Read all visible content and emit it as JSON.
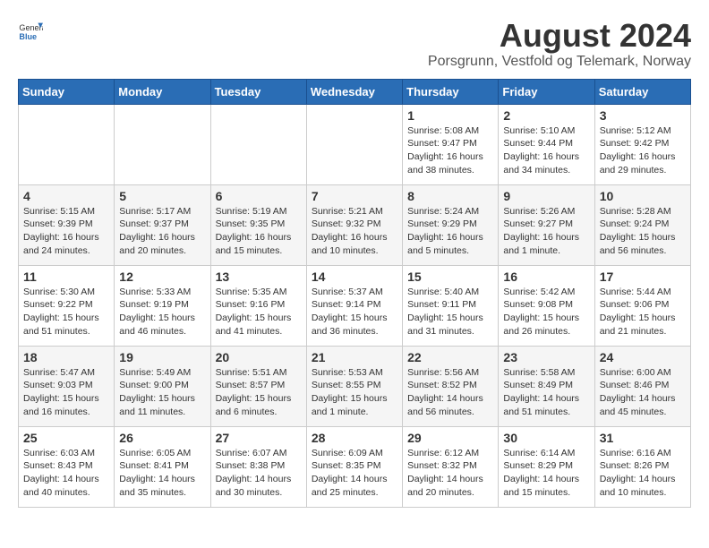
{
  "logo": {
    "general": "General",
    "blue": "Blue"
  },
  "title": "August 2024",
  "subtitle": "Porsgrunn, Vestfold og Telemark, Norway",
  "headers": [
    "Sunday",
    "Monday",
    "Tuesday",
    "Wednesday",
    "Thursday",
    "Friday",
    "Saturday"
  ],
  "weeks": [
    [
      {
        "day": "",
        "info": ""
      },
      {
        "day": "",
        "info": ""
      },
      {
        "day": "",
        "info": ""
      },
      {
        "day": "",
        "info": ""
      },
      {
        "day": "1",
        "info": "Sunrise: 5:08 AM\nSunset: 9:47 PM\nDaylight: 16 hours\nand 38 minutes."
      },
      {
        "day": "2",
        "info": "Sunrise: 5:10 AM\nSunset: 9:44 PM\nDaylight: 16 hours\nand 34 minutes."
      },
      {
        "day": "3",
        "info": "Sunrise: 5:12 AM\nSunset: 9:42 PM\nDaylight: 16 hours\nand 29 minutes."
      }
    ],
    [
      {
        "day": "4",
        "info": "Sunrise: 5:15 AM\nSunset: 9:39 PM\nDaylight: 16 hours\nand 24 minutes."
      },
      {
        "day": "5",
        "info": "Sunrise: 5:17 AM\nSunset: 9:37 PM\nDaylight: 16 hours\nand 20 minutes."
      },
      {
        "day": "6",
        "info": "Sunrise: 5:19 AM\nSunset: 9:35 PM\nDaylight: 16 hours\nand 15 minutes."
      },
      {
        "day": "7",
        "info": "Sunrise: 5:21 AM\nSunset: 9:32 PM\nDaylight: 16 hours\nand 10 minutes."
      },
      {
        "day": "8",
        "info": "Sunrise: 5:24 AM\nSunset: 9:29 PM\nDaylight: 16 hours\nand 5 minutes."
      },
      {
        "day": "9",
        "info": "Sunrise: 5:26 AM\nSunset: 9:27 PM\nDaylight: 16 hours\nand 1 minute."
      },
      {
        "day": "10",
        "info": "Sunrise: 5:28 AM\nSunset: 9:24 PM\nDaylight: 15 hours\nand 56 minutes."
      }
    ],
    [
      {
        "day": "11",
        "info": "Sunrise: 5:30 AM\nSunset: 9:22 PM\nDaylight: 15 hours\nand 51 minutes."
      },
      {
        "day": "12",
        "info": "Sunrise: 5:33 AM\nSunset: 9:19 PM\nDaylight: 15 hours\nand 46 minutes."
      },
      {
        "day": "13",
        "info": "Sunrise: 5:35 AM\nSunset: 9:16 PM\nDaylight: 15 hours\nand 41 minutes."
      },
      {
        "day": "14",
        "info": "Sunrise: 5:37 AM\nSunset: 9:14 PM\nDaylight: 15 hours\nand 36 minutes."
      },
      {
        "day": "15",
        "info": "Sunrise: 5:40 AM\nSunset: 9:11 PM\nDaylight: 15 hours\nand 31 minutes."
      },
      {
        "day": "16",
        "info": "Sunrise: 5:42 AM\nSunset: 9:08 PM\nDaylight: 15 hours\nand 26 minutes."
      },
      {
        "day": "17",
        "info": "Sunrise: 5:44 AM\nSunset: 9:06 PM\nDaylight: 15 hours\nand 21 minutes."
      }
    ],
    [
      {
        "day": "18",
        "info": "Sunrise: 5:47 AM\nSunset: 9:03 PM\nDaylight: 15 hours\nand 16 minutes."
      },
      {
        "day": "19",
        "info": "Sunrise: 5:49 AM\nSunset: 9:00 PM\nDaylight: 15 hours\nand 11 minutes."
      },
      {
        "day": "20",
        "info": "Sunrise: 5:51 AM\nSunset: 8:57 PM\nDaylight: 15 hours\nand 6 minutes."
      },
      {
        "day": "21",
        "info": "Sunrise: 5:53 AM\nSunset: 8:55 PM\nDaylight: 15 hours\nand 1 minute."
      },
      {
        "day": "22",
        "info": "Sunrise: 5:56 AM\nSunset: 8:52 PM\nDaylight: 14 hours\nand 56 minutes."
      },
      {
        "day": "23",
        "info": "Sunrise: 5:58 AM\nSunset: 8:49 PM\nDaylight: 14 hours\nand 51 minutes."
      },
      {
        "day": "24",
        "info": "Sunrise: 6:00 AM\nSunset: 8:46 PM\nDaylight: 14 hours\nand 45 minutes."
      }
    ],
    [
      {
        "day": "25",
        "info": "Sunrise: 6:03 AM\nSunset: 8:43 PM\nDaylight: 14 hours\nand 40 minutes."
      },
      {
        "day": "26",
        "info": "Sunrise: 6:05 AM\nSunset: 8:41 PM\nDaylight: 14 hours\nand 35 minutes."
      },
      {
        "day": "27",
        "info": "Sunrise: 6:07 AM\nSunset: 8:38 PM\nDaylight: 14 hours\nand 30 minutes."
      },
      {
        "day": "28",
        "info": "Sunrise: 6:09 AM\nSunset: 8:35 PM\nDaylight: 14 hours\nand 25 minutes."
      },
      {
        "day": "29",
        "info": "Sunrise: 6:12 AM\nSunset: 8:32 PM\nDaylight: 14 hours\nand 20 minutes."
      },
      {
        "day": "30",
        "info": "Sunrise: 6:14 AM\nSunset: 8:29 PM\nDaylight: 14 hours\nand 15 minutes."
      },
      {
        "day": "31",
        "info": "Sunrise: 6:16 AM\nSunset: 8:26 PM\nDaylight: 14 hours\nand 10 minutes."
      }
    ]
  ]
}
